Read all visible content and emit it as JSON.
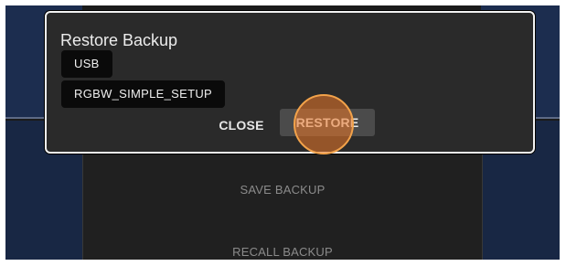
{
  "background": {
    "menu": {
      "save_label": "SAVE BACKUP",
      "recall_label": "RECALL BACKUP"
    }
  },
  "dialog": {
    "title": "Restore Backup",
    "source_label": "USB",
    "file_label": "RGBW_SIMPLE_SETUP",
    "close_label": "CLOSE",
    "restore_label": "RESTORE"
  },
  "colors": {
    "panel_blue": "#1c2d4f",
    "tap_indicator": "#ec7828",
    "dialog_border": "#f2f2f2"
  }
}
